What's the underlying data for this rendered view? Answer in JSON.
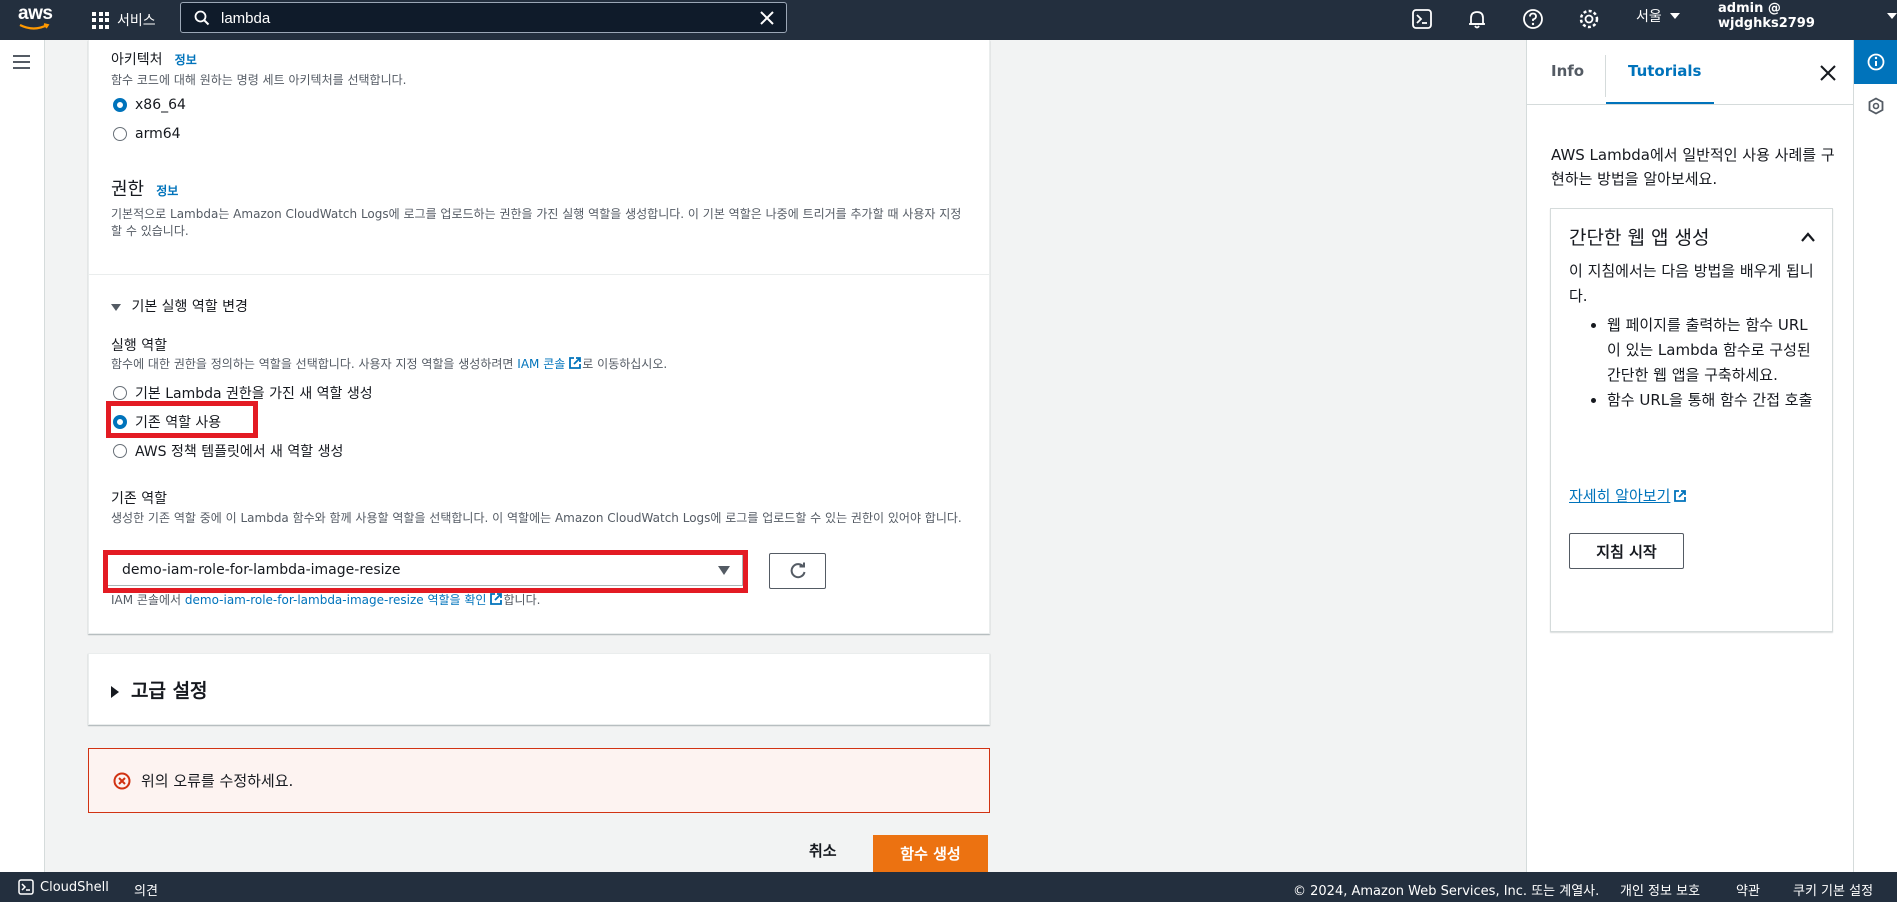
{
  "topnav": {
    "logo_text": "aws",
    "services_label": "서비스",
    "search_value": "lambda",
    "region_label": "서울",
    "account_label": "admin @ wjdghks2799"
  },
  "main": {
    "architecture": {
      "label": "아키텍처",
      "info": "정보",
      "desc": "함수 코드에 대해 원하는 명령 세트 아키텍처를 선택합니다.",
      "options": [
        "x86_64",
        "arm64"
      ],
      "selected": "x86_64"
    },
    "permissions": {
      "title": "권한",
      "info": "정보",
      "desc": "기본적으로 Lambda는 Amazon CloudWatch Logs에 로그를 업로드하는 권한을 가진 실행 역할을 생성합니다. 이 기본 역할은 나중에 트리거를 추가할 때 사용자 지정할 수 있습니다."
    },
    "role_expander": "기본 실행 역할 변경",
    "exec_role": {
      "label": "실행 역할",
      "desc_prefix": "함수에 대한 권한을 정의하는 역할을 선택합니다. 사용자 지정 역할을 생성하려면 ",
      "desc_link": "IAM 콘솔",
      "desc_suffix": "로 이동하십시오.",
      "options": [
        "기본 Lambda 권한을 가진 새 역할 생성",
        "기존 역할 사용",
        "AWS 정책 템플릿에서 새 역할 생성"
      ],
      "selected": "기존 역할 사용"
    },
    "existing_role": {
      "label": "기존 역할",
      "desc": "생성한 기존 역할 중에 이 Lambda 함수와 함께 사용할 역할을 선택합니다. 이 역할에는 Amazon CloudWatch Logs에 로그를 업로드할 수 있는 권한이 있어야 합니다.",
      "value": "demo-iam-role-for-lambda-image-resize",
      "hint_prefix": "IAM 콘솔에서 ",
      "hint_link": "demo-iam-role-for-lambda-image-resize 역할을 확인",
      "hint_suffix": "합니다."
    },
    "advanced": "고급 설정",
    "error": "위의 오류를 수정하세요.",
    "cancel": "취소",
    "create": "함수 생성"
  },
  "help": {
    "tabs": [
      "Info",
      "Tutorials"
    ],
    "active_tab": "Tutorials",
    "intro": "AWS Lambda에서 일반적인 사용 사례를 구현하는 방법을 알아보세요.",
    "tutorial": {
      "title": "간단한 웹 앱 생성",
      "body": "이 지침에서는 다음 방법을 배우게 됩니다.",
      "bullets": [
        "웹 페이지를 출력하는 함수 URL이 있는 Lambda 함수로 구성된 간단한 웹 앱을 구축하세요.",
        "함수 URL을 통해 함수 간접 호출"
      ],
      "learn_more": "자세히 알아보기",
      "start": "지침 시작"
    }
  },
  "footer": {
    "cloudshell": "CloudShell",
    "feedback": "의견",
    "copyright": "© 2024, Amazon Web Services, Inc. 또는 계열사.",
    "privacy": "개인 정보 보호",
    "terms": "약관",
    "cookies": "쿠키 기본 설정"
  },
  "colors": {
    "nav_bg": "#232f3e",
    "accent": "#0073bb",
    "primary": "#ec7211",
    "error": "#d13212",
    "highlight": "#e31b23"
  }
}
